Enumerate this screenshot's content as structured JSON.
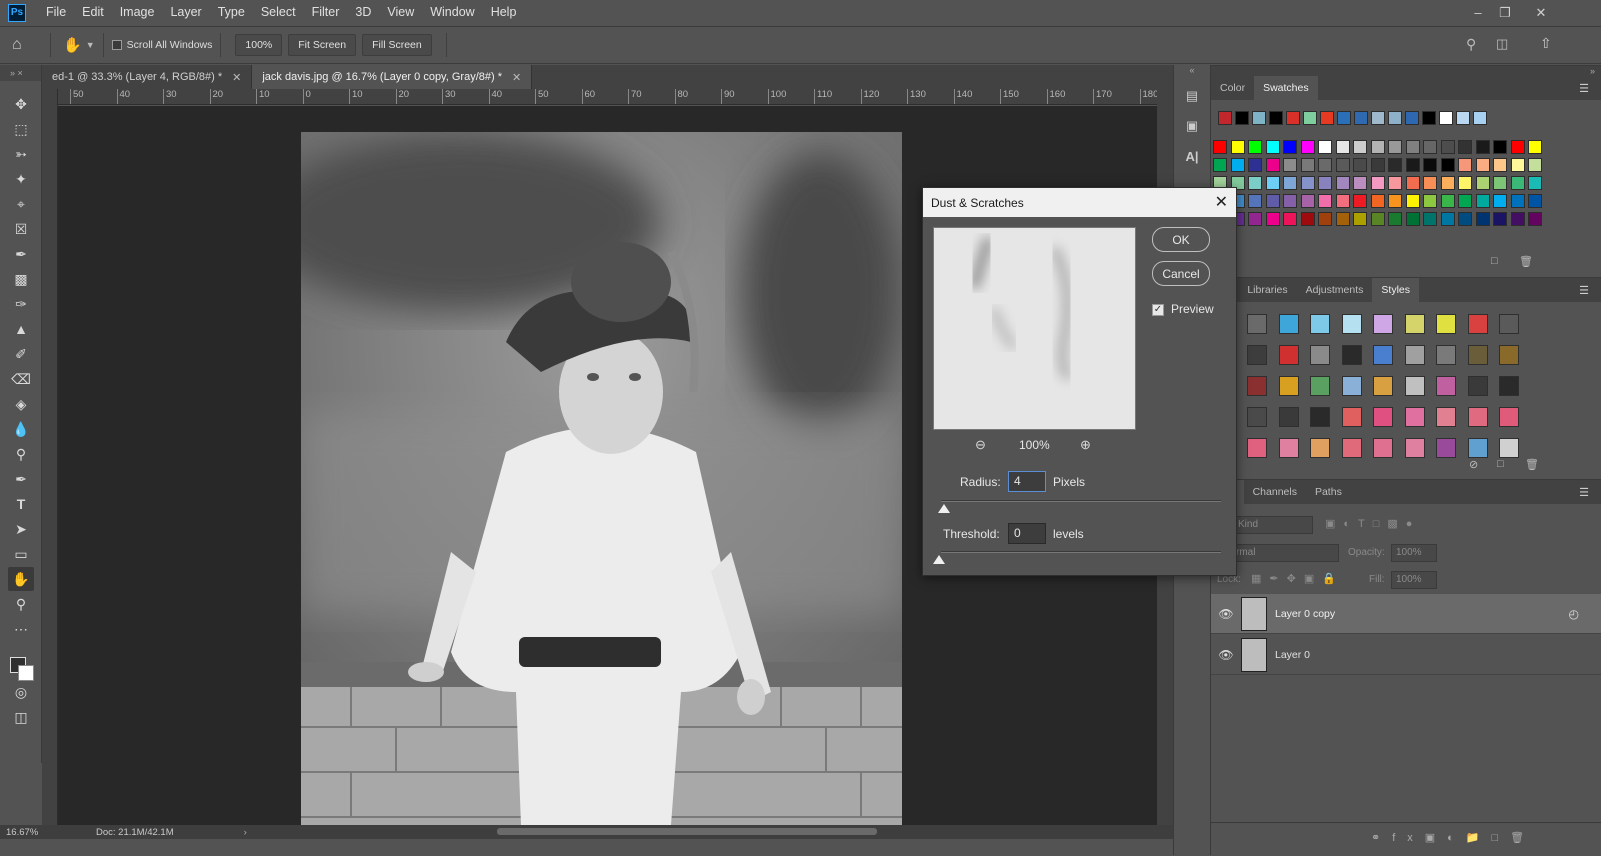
{
  "app": {
    "logo": "Ps"
  },
  "menu": [
    "File",
    "Edit",
    "Image",
    "Layer",
    "Type",
    "Select",
    "Filter",
    "3D",
    "View",
    "Window",
    "Help"
  ],
  "options": {
    "scroll_all_windows": "Scroll All Windows",
    "zoom_value": "100%",
    "fit_screen": "Fit Screen",
    "fill_screen": "Fill Screen"
  },
  "tabs": [
    {
      "label": "ed-1 @ 33.3% (Layer 4, RGB/8#) *",
      "active": false
    },
    {
      "label": "jack davis.jpg @ 16.7% (Layer 0 copy, Gray/8#) *",
      "active": true
    }
  ],
  "ruler": {
    "ticks": [
      "50",
      "40",
      "30",
      "20",
      "10",
      "0",
      "10",
      "20",
      "30",
      "40",
      "50",
      "60",
      "70",
      "80",
      "90",
      "100",
      "110",
      "120",
      "130",
      "140",
      "150",
      "160",
      "170",
      "180"
    ]
  },
  "status": {
    "zoom": "16.67%",
    "doc": "Doc: 21.1M/42.1M"
  },
  "color_panel": {
    "tabs": [
      "Color",
      "Swatches"
    ],
    "active": "Swatches"
  },
  "styles_panel": {
    "tabs": [
      "rn",
      "Libraries",
      "Adjustments",
      "Styles"
    ],
    "active": "Styles"
  },
  "layers_panel": {
    "tabs": [
      "ers",
      "Channels",
      "Paths"
    ],
    "kind": "Kind",
    "blend": "rmal",
    "opacity_label": "Opacity:",
    "opacity_value": "100%",
    "lock_label": "Lock:",
    "fill_label": "Fill:",
    "fill_value": "100%",
    "layers": [
      {
        "name": "Layer 0 copy",
        "selected": true
      },
      {
        "name": "Layer 0",
        "selected": false
      }
    ]
  },
  "dialog": {
    "title": "Dust & Scratches",
    "ok": "OK",
    "cancel": "Cancel",
    "preview_label": "Preview",
    "preview_checked": true,
    "zoom": "100%",
    "radius_label": "Radius:",
    "radius_value": "4",
    "radius_unit": "Pixels",
    "threshold_label": "Threshold:",
    "threshold_value": "0",
    "threshold_unit": "levels"
  }
}
